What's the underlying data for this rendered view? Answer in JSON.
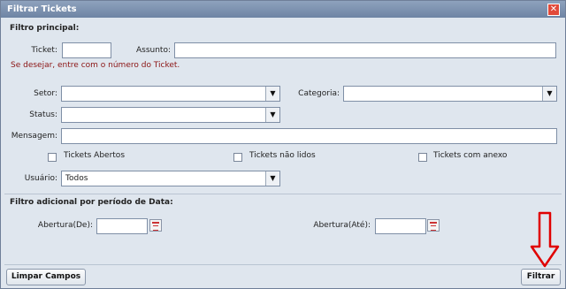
{
  "dialog": {
    "title": "Filtrar Tickets",
    "close_symbol": "✕"
  },
  "main_filter": {
    "section_title": "Filtro principal:",
    "ticket_label": "Ticket:",
    "ticket_value": "",
    "assunto_label": "Assunto:",
    "assunto_value": "",
    "hint": "Se desejar, entre com o número do Ticket.",
    "setor_label": "Setor:",
    "setor_value": "",
    "categoria_label": "Categoria:",
    "categoria_value": "",
    "status_label": "Status:",
    "status_value": "",
    "mensagem_label": "Mensagem:",
    "mensagem_value": "",
    "check_abertos": "Tickets Abertos",
    "check_nao_lidos": "Tickets não lidos",
    "check_anexo": "Tickets com anexo",
    "usuario_label": "Usuário:",
    "usuario_value": "Todos"
  },
  "date_filter": {
    "section_title": "Filtro adicional por período de Data:",
    "abertura_de_label": "Abertura(De):",
    "abertura_de_value": "",
    "abertura_ate_label": "Abertura(Até):",
    "abertura_ate_value": ""
  },
  "footer": {
    "clear_label": "Limpar Campos",
    "filter_label": "Filtrar"
  },
  "colors": {
    "annotation_arrow": "#e00000",
    "hint_text": "#8b1414"
  }
}
